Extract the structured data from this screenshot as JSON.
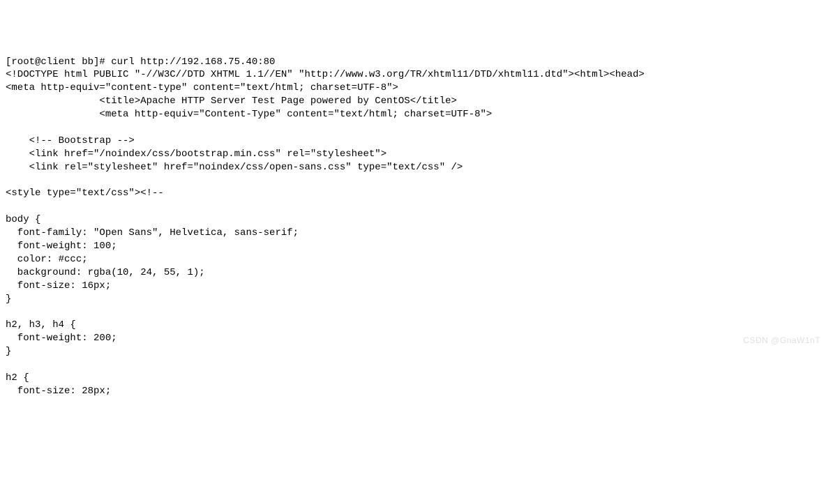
{
  "terminal": {
    "lines": [
      "[root@client bb]# curl http://192.168.75.40:80",
      "<!DOCTYPE html PUBLIC \"-//W3C//DTD XHTML 1.1//EN\" \"http://www.w3.org/TR/xhtml11/DTD/xhtml11.dtd\"><html><head>",
      "<meta http-equiv=\"content-type\" content=\"text/html; charset=UTF-8\">",
      "                <title>Apache HTTP Server Test Page powered by CentOS</title>",
      "                <meta http-equiv=\"Content-Type\" content=\"text/html; charset=UTF-8\">",
      "",
      "    <!-- Bootstrap -->",
      "    <link href=\"/noindex/css/bootstrap.min.css\" rel=\"stylesheet\">",
      "    <link rel=\"stylesheet\" href=\"noindex/css/open-sans.css\" type=\"text/css\" />",
      "",
      "<style type=\"text/css\"><!--",
      "",
      "body {",
      "  font-family: \"Open Sans\", Helvetica, sans-serif;",
      "  font-weight: 100;",
      "  color: #ccc;",
      "  background: rgba(10, 24, 55, 1);",
      "  font-size: 16px;",
      "}",
      "",
      "h2, h3, h4 {",
      "  font-weight: 200;",
      "}",
      "",
      "h2 {",
      "  font-size: 28px;"
    ]
  },
  "watermark": "CSDN @GnaW1nT"
}
